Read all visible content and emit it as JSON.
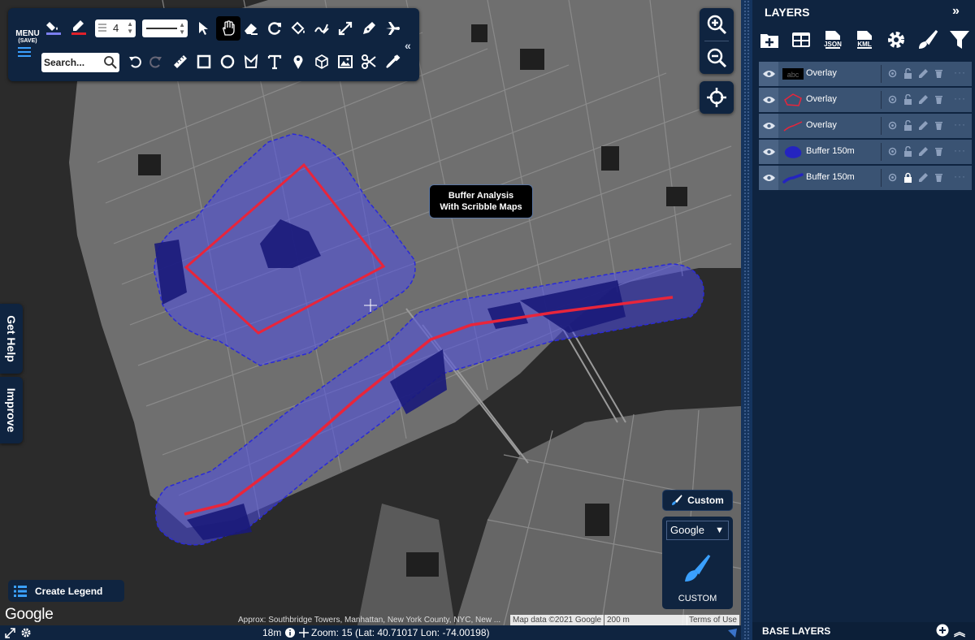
{
  "app": "Scribble Maps",
  "toolbar": {
    "menu_label": "MENU",
    "menu_sub": "(SAVE)",
    "line_width": "4",
    "search_placeholder": "Search...",
    "fill_color": "#7b7ff0",
    "stroke_color": "#e0202a",
    "tools": [
      "select-arrow",
      "hand-pan",
      "eraser",
      "refresh",
      "paint-bucket",
      "scribble-pen",
      "resize",
      "pen-nib",
      "airplane",
      "undo",
      "redo",
      "ruler",
      "rectangle",
      "circle",
      "polygon",
      "text",
      "map-marker",
      "cube",
      "image",
      "scissors",
      "eyedropper"
    ]
  },
  "map": {
    "callout_line1": "Buffer Analysis",
    "callout_line2": "With Scribble Maps",
    "polygon_color": "#e8253b",
    "buffer_fill": "#4f4fe6",
    "buffer_outline": "#2a2ad8"
  },
  "side": {
    "help": "Get Help",
    "improve": "Improve"
  },
  "legend_label": "Create Legend",
  "google": "Google",
  "style_panel": {
    "custom_button": "Custom",
    "source": "Google",
    "custom_label": "CUSTOM"
  },
  "attribution": {
    "address": "Approx: Southbridge Towers, Manhattan, New York County, NYC, New ...",
    "map_data": "Map data ©2021 Google",
    "scale": "200 m",
    "terms": "Terms of Use"
  },
  "status": {
    "elevation": "18m",
    "zoom_text": "Zoom: 15 (Lat: 40.71017 Lon: -74.00198)"
  },
  "layers_panel": {
    "title": "LAYERS",
    "tools": [
      "add-layer",
      "table",
      "JSON",
      "KML",
      "settings",
      "brush",
      "filter"
    ],
    "json_label": "JSON",
    "kml_label": "KML",
    "items": [
      {
        "name": "Overlay",
        "type": "text",
        "locked": false
      },
      {
        "name": "Overlay",
        "type": "polygon",
        "locked": false
      },
      {
        "name": "Overlay",
        "type": "line",
        "locked": false
      },
      {
        "name": "Buffer 150m",
        "type": "buffer-polygon",
        "locked": false
      },
      {
        "name": "Buffer 150m",
        "type": "buffer-line",
        "locked": true
      }
    ],
    "thumb_text": "abc",
    "base_layers": "BASE LAYERS"
  }
}
